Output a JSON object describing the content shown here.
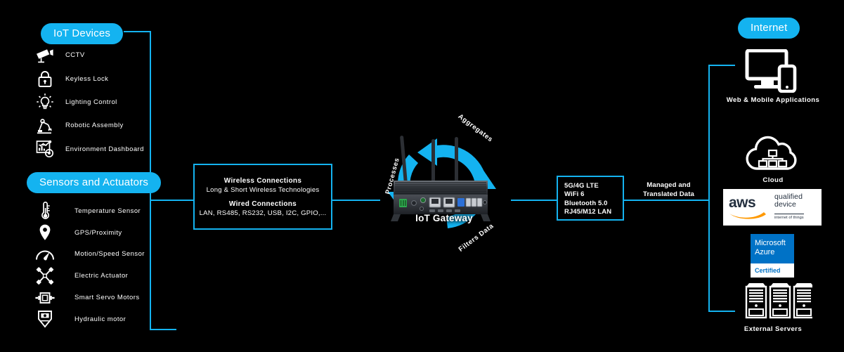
{
  "pills": {
    "iot_devices": "IoT Devices",
    "sensors_actuators": "Sensors and Actuators",
    "internet": "Internet"
  },
  "iot_devices": {
    "items": [
      {
        "icon": "cctv-camera-icon",
        "label": "CCTV"
      },
      {
        "icon": "padlock-icon",
        "label": "Keyless Lock"
      },
      {
        "icon": "lightbulb-icon",
        "label": "Lighting Control"
      },
      {
        "icon": "robot-arm-icon",
        "label": "Robotic Assembly"
      },
      {
        "icon": "dashboard-chart-icon",
        "label": "Environment Dashboard"
      }
    ]
  },
  "sensors": {
    "items": [
      {
        "icon": "thermometer-icon",
        "label": "Temperature Sensor"
      },
      {
        "icon": "map-pin-icon",
        "label": "GPS/Proximity"
      },
      {
        "icon": "speedometer-icon",
        "label": "Motion/Speed Sensor"
      },
      {
        "icon": "crossed-actuators-icon",
        "label": "Electric Actuator"
      },
      {
        "icon": "servo-motor-icon",
        "label": "Smart Servo Motors"
      },
      {
        "icon": "hydraulic-motor-icon",
        "label": "Hydraulic motor"
      }
    ]
  },
  "connections_box": {
    "wireless_title": "Wireless Connections",
    "wireless_detail": "Long & Short Wireless Technologies",
    "wired_title": "Wired Connections",
    "wired_detail": "LAN, RS485, RS232, USB, I2C, GPIO,..."
  },
  "gateway": {
    "caption": "IoT Gateway",
    "arc_labels": {
      "left": "Processes",
      "top": "Aggregates",
      "bottom": "Filters Data"
    }
  },
  "specs_box": {
    "lines": [
      "5G/4G LTE",
      "WiFi 6",
      "Bluetooth 5.0",
      "RJ45/M12 LAN"
    ]
  },
  "managed_label": {
    "line1": "Managed and",
    "line2": "Translated Data"
  },
  "internet_items": {
    "web": {
      "icon": "monitor-phone-icon",
      "caption": "Web & Mobile Applications"
    },
    "cloud": {
      "icon": "cloud-network-icon",
      "caption": "Cloud"
    },
    "servers": {
      "icon": "server-tower-icon",
      "caption": "External Servers"
    }
  },
  "badges": {
    "aws": {
      "wordmark": "aws",
      "line1": "qualified",
      "line2": "device",
      "tagline": "internet of things"
    },
    "azure": {
      "brand_line1": "Microsoft",
      "brand_line2": "Azure",
      "status": "Certified"
    }
  },
  "colors": {
    "accent": "#14B3F0",
    "background": "#000000",
    "text": "#FFFFFF",
    "aws_orange": "#FF9900",
    "aws_dark": "#232F3E",
    "azure_blue": "#0072C6"
  }
}
